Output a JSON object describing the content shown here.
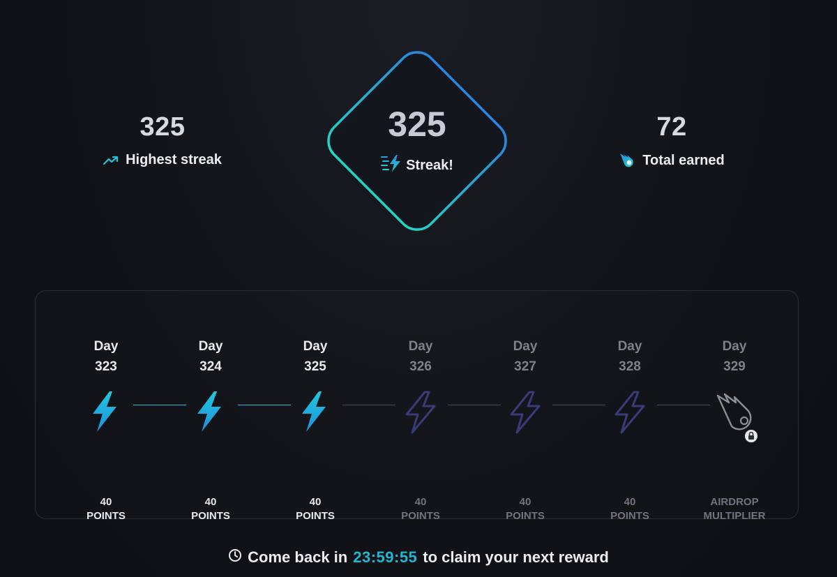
{
  "stats": {
    "highest": {
      "value": "325",
      "label": "Highest streak",
      "icon": "trending-up-icon"
    },
    "total": {
      "value": "72",
      "label": "Total earned",
      "icon": "comet-icon"
    }
  },
  "streak": {
    "value": "325",
    "label": "Streak!",
    "icon": "fast-bolt-icon"
  },
  "days": [
    {
      "word": "Day",
      "number": "323",
      "reward_line1": "40",
      "reward_line2": "POINTS",
      "state": "claimed",
      "icon": "bolt-icon"
    },
    {
      "word": "Day",
      "number": "324",
      "reward_line1": "40",
      "reward_line2": "POINTS",
      "state": "claimed",
      "icon": "bolt-icon"
    },
    {
      "word": "Day",
      "number": "325",
      "reward_line1": "40",
      "reward_line2": "POINTS",
      "state": "claimed",
      "icon": "bolt-icon"
    },
    {
      "word": "Day",
      "number": "326",
      "reward_line1": "40",
      "reward_line2": "POINTS",
      "state": "upcoming",
      "icon": "bolt-outline-icon"
    },
    {
      "word": "Day",
      "number": "327",
      "reward_line1": "40",
      "reward_line2": "POINTS",
      "state": "upcoming",
      "icon": "bolt-outline-icon"
    },
    {
      "word": "Day",
      "number": "328",
      "reward_line1": "40",
      "reward_line2": "POINTS",
      "state": "upcoming",
      "icon": "bolt-outline-icon"
    },
    {
      "word": "Day",
      "number": "329",
      "reward_line1": "AIRDROP",
      "reward_line2": "MULTIPLIER",
      "state": "locked",
      "icon": "comet-locked-icon"
    }
  ],
  "footer": {
    "prefix": "Come back in",
    "timer": "23:59:55",
    "suffix": "to claim your next reward",
    "icon": "clock-icon"
  },
  "colors": {
    "accent": "#1fb7d4",
    "accent_blue": "#2a86e0",
    "accent_teal": "#1fd6c8",
    "upcoming_icon": "#3b3a78"
  }
}
